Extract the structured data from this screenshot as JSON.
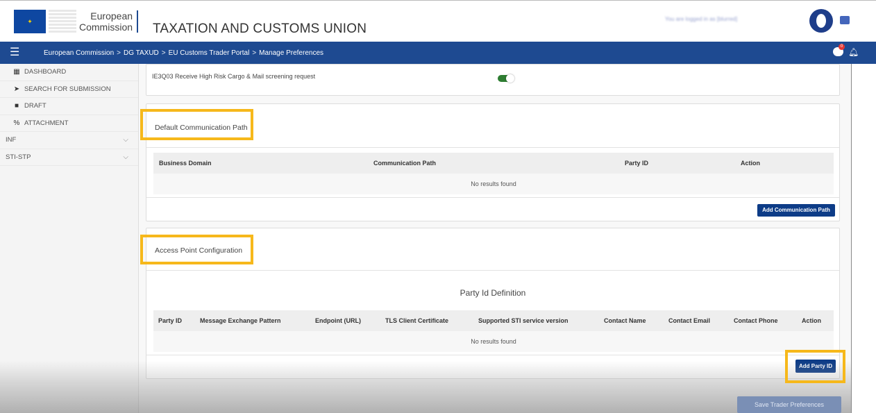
{
  "header": {
    "logo_line1": "European",
    "logo_line2": "Commission",
    "app_title": "TAXATION AND CUSTOMS UNION",
    "user_text": "You are logged in as [blurred]"
  },
  "navbar": {
    "breadcrumb": [
      "European Commission",
      "DG TAXUD",
      "EU Customs Trader Portal",
      "Manage Preferences"
    ],
    "separator": ">",
    "notification_count": "0"
  },
  "sidebar": {
    "items": [
      {
        "label": "DASHBOARD",
        "icon": "dashboard-icon",
        "glyph": "▦"
      },
      {
        "label": "SEARCH FOR SUBMISSION",
        "icon": "send-icon",
        "glyph": "➤"
      },
      {
        "label": "DRAFT",
        "icon": "file-icon",
        "glyph": "■"
      },
      {
        "label": "ATTACHMENT",
        "icon": "paperclip-icon",
        "glyph": "%"
      },
      {
        "label": "INF",
        "icon": "",
        "glyph": "",
        "chevron": "⌵"
      },
      {
        "label": "STI-STP",
        "icon": "",
        "glyph": "",
        "chevron": "⌵"
      }
    ]
  },
  "screening": {
    "label": "IE3Q03 Receive High Risk Cargo & Mail screening request",
    "toggle_on": true
  },
  "communication_path": {
    "title": "Default Communication Path",
    "columns": [
      "Business Domain",
      "Communication Path",
      "Party ID",
      "Action"
    ],
    "empty_text": "No results found",
    "add_button": "Add Communication Path"
  },
  "access_point": {
    "title": "Access Point Configuration",
    "subtitle": "Party Id Definition",
    "columns": [
      "Party ID",
      "Message Exchange Pattern",
      "Endpoint (URL)",
      "TLS Client Certificate",
      "Supported STI service version",
      "Contact Name",
      "Contact Email",
      "Contact Phone",
      "Action"
    ],
    "empty_text": "No results found",
    "add_button": "Add Party ID"
  },
  "footer": {
    "save_button": "Save Trader Preferences"
  },
  "colors": {
    "brand_blue": "#1e4a91",
    "button_blue": "#0d3c87",
    "highlight": "#f6b81b",
    "toggle_green": "#2e7d32"
  }
}
